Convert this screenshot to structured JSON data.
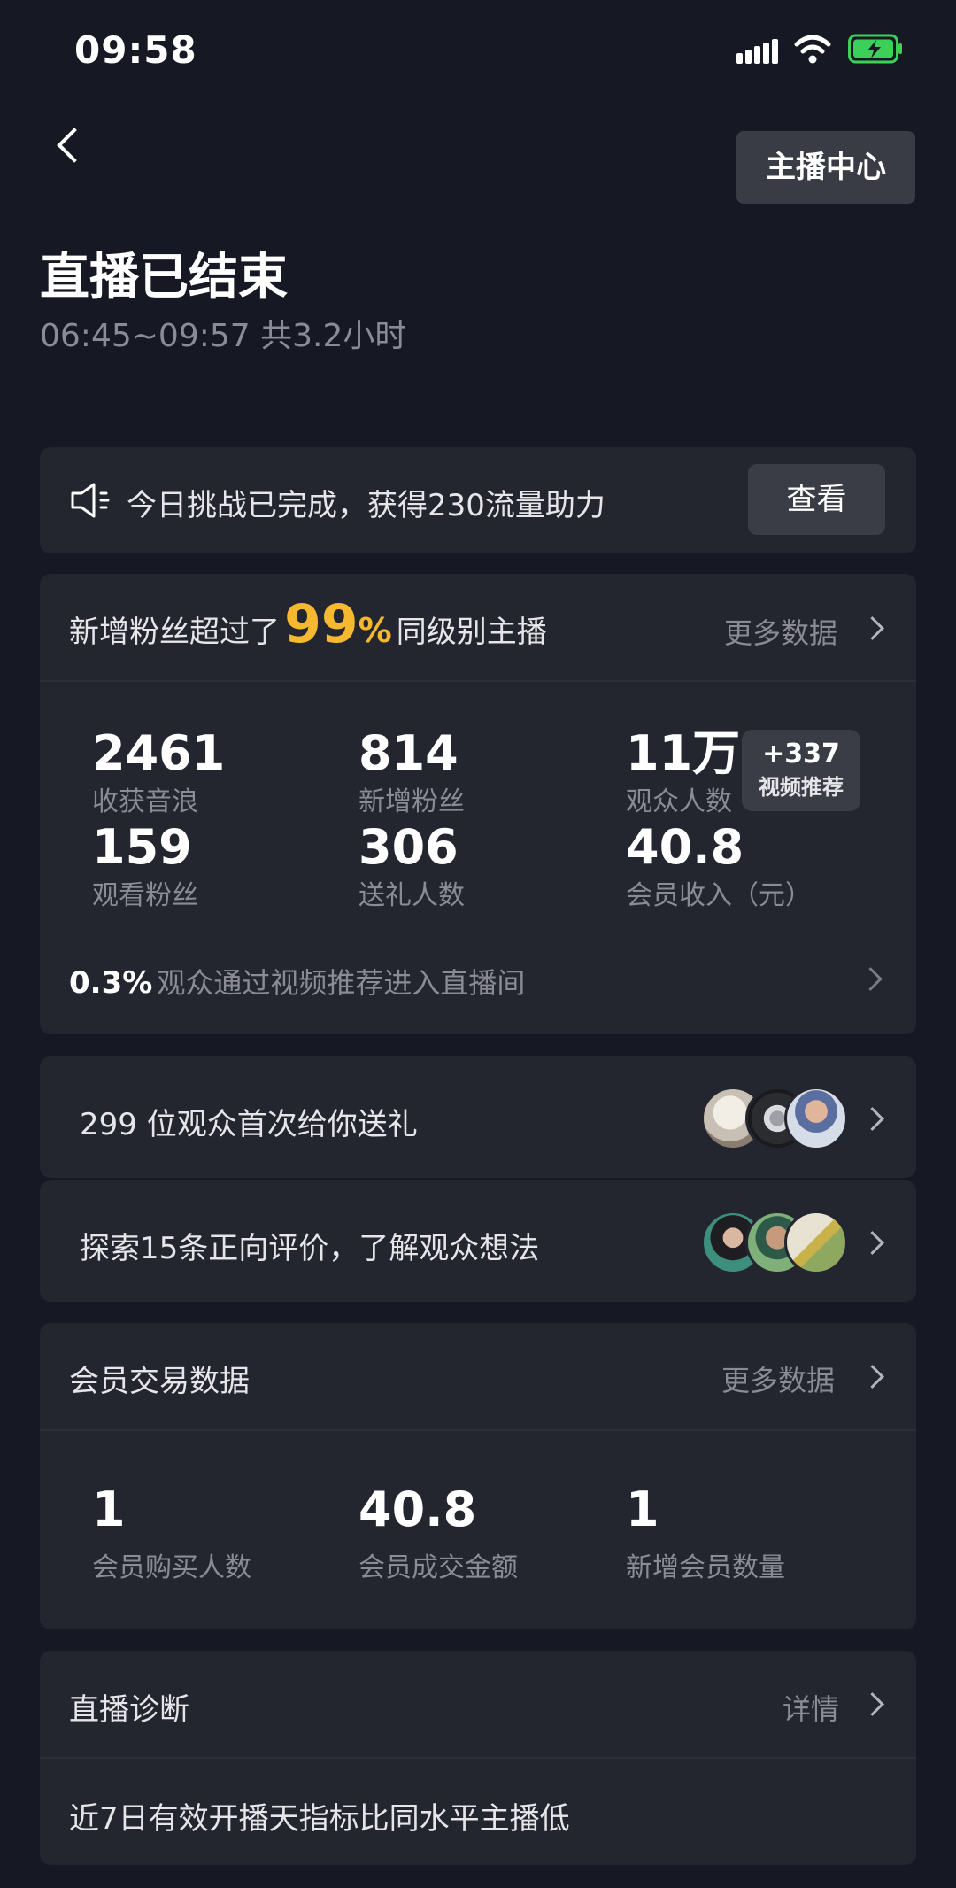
{
  "status": {
    "time": "09:58"
  },
  "header": {
    "center_button": "主播中心",
    "title": "直播已结束",
    "subtitle": "06:45~09:57 共3.2小时"
  },
  "challenge": {
    "text": "今日挑战已完成，获得230流量助力",
    "button": "查看"
  },
  "overview": {
    "headline_prefix": "新增粉丝超过了",
    "percent": "99",
    "percent_sign": "%",
    "headline_suffix": "同级别主播",
    "more_link": "更多数据",
    "metrics": [
      {
        "value": "2461",
        "label": "收获音浪"
      },
      {
        "value": "814",
        "label": "新增粉丝"
      },
      {
        "value": "11万",
        "label": "观众人数"
      },
      {
        "value": "159",
        "label": "观看粉丝"
      },
      {
        "value": "306",
        "label": "送礼人数"
      },
      {
        "value": "40.8",
        "label": "会员收入（元）"
      }
    ],
    "badge": {
      "value": "+337",
      "label": "视频推荐"
    },
    "footer_value": "0.3%",
    "footer_text": "观众通过视频推荐进入直播间"
  },
  "gifts_row": {
    "text": "299 位观众首次给你送礼"
  },
  "reviews_row": {
    "text": "探索15条正向评价，了解观众想法"
  },
  "membership": {
    "title": "会员交易数据",
    "more_link": "更多数据",
    "metrics": [
      {
        "value": "1",
        "label": "会员购买人数"
      },
      {
        "value": "40.8",
        "label": "会员成交金额"
      },
      {
        "value": "1",
        "label": "新增会员数量"
      }
    ]
  },
  "diagnosis": {
    "title": "直播诊断",
    "link": "详情",
    "text": "近7日有效开播天指标比同水平主播低"
  },
  "colors": {
    "background": "#161823",
    "card": "#23252f",
    "accent": "#f5b82e"
  },
  "icons": [
    "signal-icon",
    "wifi-icon",
    "battery-charging-icon",
    "back-arrow-icon",
    "speaker-icon",
    "chevron-right-icon"
  ]
}
